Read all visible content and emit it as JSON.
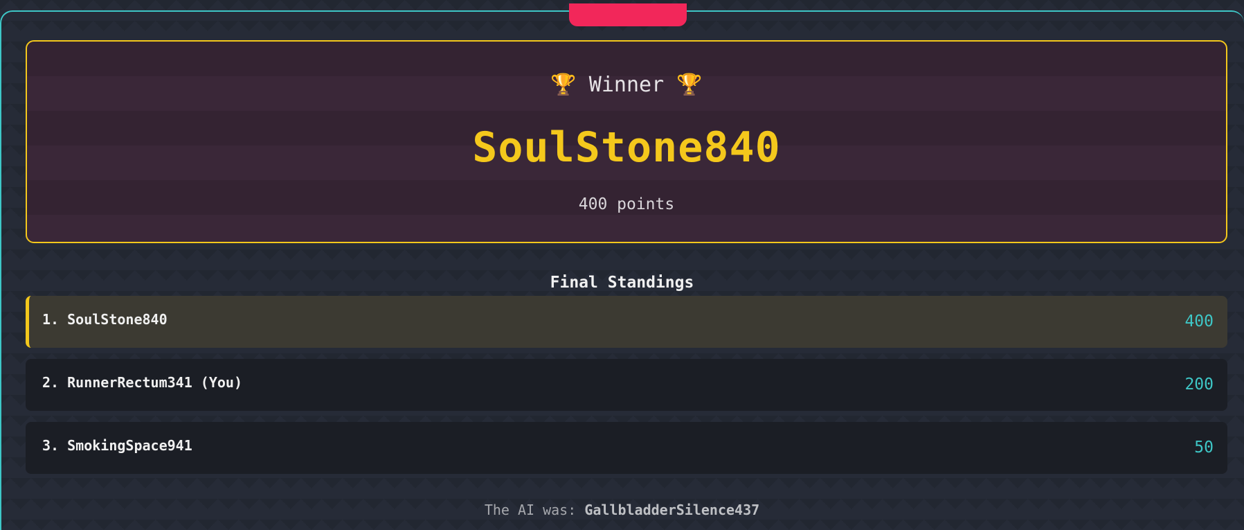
{
  "colors": {
    "accent": "#3ec7c7",
    "winner_gold": "#f4c81c",
    "tab_pink": "#f2275a",
    "card_bg": "#3a2738",
    "row_bg": "#1b1e25",
    "page_bg": "#262b37"
  },
  "winner": {
    "heading": "🏆 Winner 🏆",
    "name": "SoulStone840",
    "points": "400 points"
  },
  "standings": {
    "title": "Final Standings",
    "rows": [
      {
        "label": "1. SoulStone840",
        "score": "400"
      },
      {
        "label": "2. RunnerRectum341 (You)",
        "score": "200"
      },
      {
        "label": "3. SmokingSpace941",
        "score": "50"
      }
    ]
  },
  "footer": {
    "prefix": "The AI was: ",
    "ai_name": "GallbladderSilence437"
  }
}
